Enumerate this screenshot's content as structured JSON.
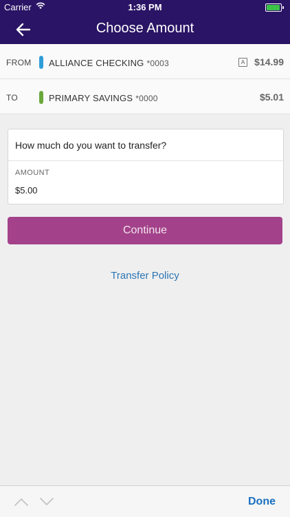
{
  "status_bar": {
    "carrier": "Carrier",
    "time": "1:36 PM"
  },
  "header": {
    "title": "Choose Amount",
    "back_icon": "back-arrow-icon"
  },
  "from_account": {
    "label": "FROM",
    "name": "ALLIANCE CHECKING",
    "number": "*0003",
    "badge": "A",
    "balance": "$14.99",
    "color": "#2f9ed8"
  },
  "to_account": {
    "label": "TO",
    "name": "PRIMARY SAVINGS",
    "number": "*0000",
    "balance": "$5.01",
    "color": "#6aa83c"
  },
  "amount_card": {
    "question": "How much do you want to transfer?",
    "amount_label": "AMOUNT",
    "amount_value": "$5.00"
  },
  "continue_label": "Continue",
  "policy_link": "Transfer Policy",
  "keyboard_toolbar": {
    "done_label": "Done"
  },
  "colors": {
    "header_bg": "#2a1465",
    "accent": "#a3428a",
    "link": "#2d76b4"
  }
}
